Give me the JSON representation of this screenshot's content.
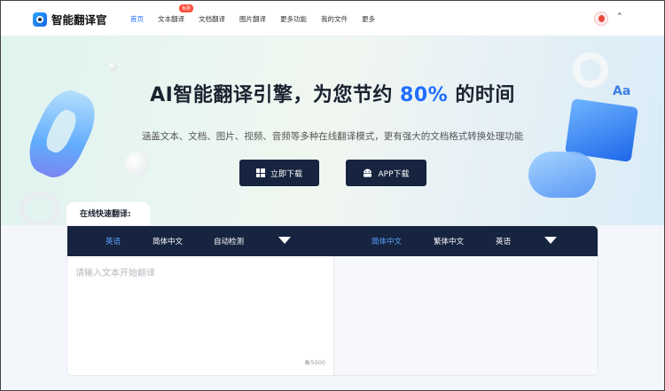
{
  "app": {
    "name": "智能翻译官"
  },
  "nav": {
    "items": [
      {
        "label": "首页",
        "active": true
      },
      {
        "label": "文本翻译",
        "badge": "免费"
      },
      {
        "label": "文档翻译"
      },
      {
        "label": "图片翻译"
      },
      {
        "label": "更多功能"
      },
      {
        "label": "我的文件"
      },
      {
        "label": "更多"
      }
    ]
  },
  "hero": {
    "title_prefix": "AI智能翻译引擎，为您节约",
    "title_highlight": "80%",
    "title_suffix": "的时间",
    "subtitle": "涵盖文本、文档、图片、视频、音频等多种在线翻译模式，更有强大的文档格式转换处理功能",
    "download_button": "立即下载",
    "app_button": "APP下载"
  },
  "translator": {
    "tab_label": "在线快速翻译:",
    "source_langs": [
      "英语",
      "简体中文",
      "自动检测"
    ],
    "target_langs": [
      "简体中文",
      "繁体中文",
      "英语"
    ],
    "input_placeholder": "请输入文本开始翻译",
    "count_current": "0",
    "count_max": "/5000"
  },
  "colors": {
    "accent": "#1f6fff",
    "dark": "#16243f",
    "badge": "#ff4d3a"
  }
}
